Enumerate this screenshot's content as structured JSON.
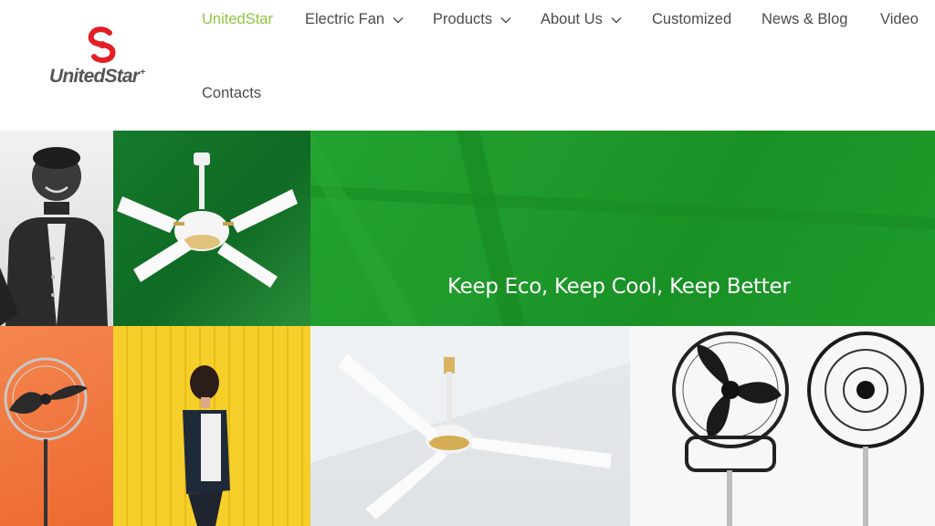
{
  "brand": {
    "name": "UnitedStar",
    "plus": "+",
    "logo_color": "#e31e24",
    "text_color": "#555555"
  },
  "nav": {
    "items": [
      {
        "label": "UnitedStar",
        "active": true
      },
      {
        "label": "Electric Fan",
        "dropdown": true
      },
      {
        "label": "Products",
        "dropdown": true
      },
      {
        "label": "About Us",
        "dropdown": true
      },
      {
        "label": "Customized"
      },
      {
        "label": "News & Blog"
      },
      {
        "label": "Video"
      },
      {
        "label": "Contacts"
      }
    ],
    "active_color": "#8dc63f",
    "text_color": "#4a4a4a"
  },
  "banner": {
    "slogan": "Keep Eco, Keep Cool, Keep Better",
    "slogan_bg": "#1f9a2c"
  }
}
